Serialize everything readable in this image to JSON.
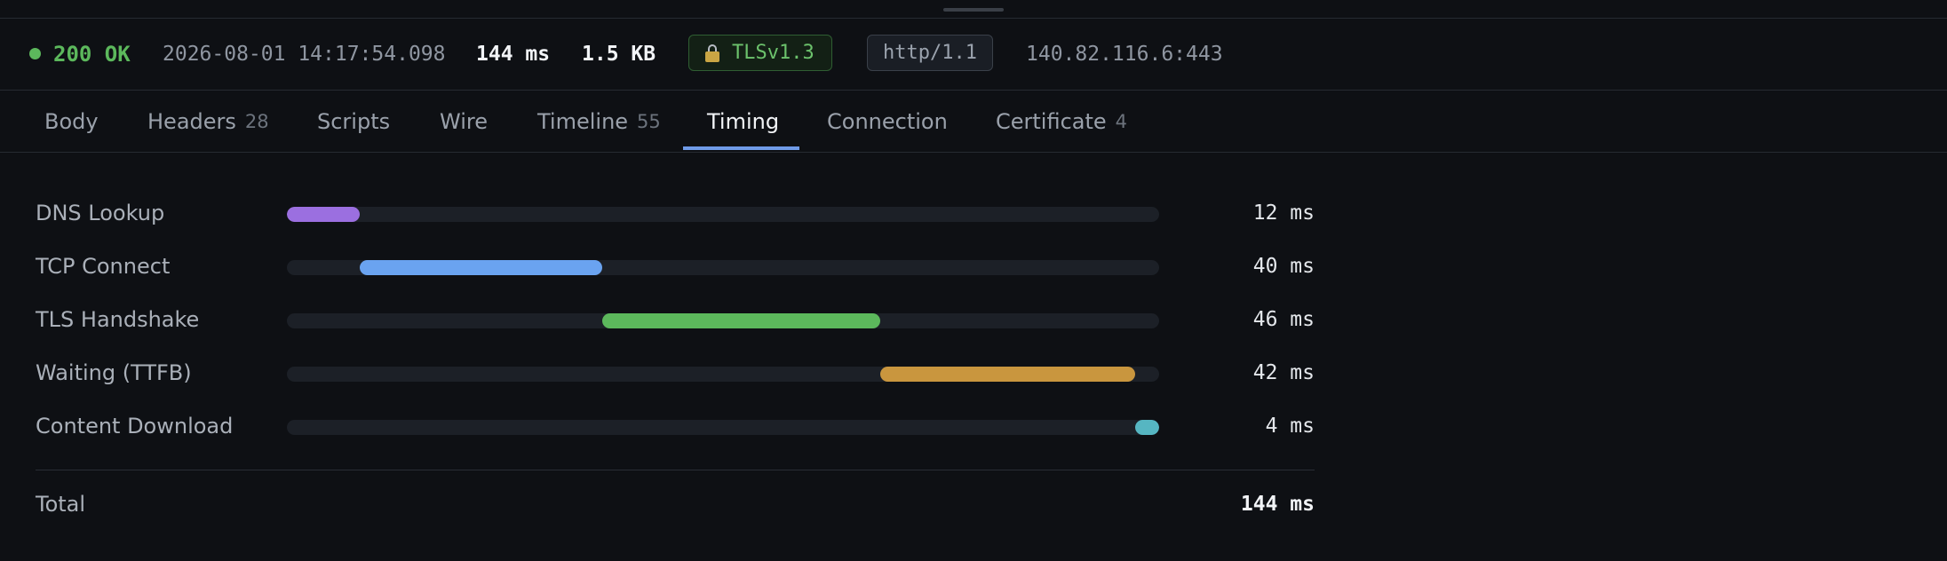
{
  "status": {
    "code_text": "200 OK",
    "timestamp": "2026-08-01 14:17:54.098",
    "duration": "144 ms",
    "size": "1.5 KB",
    "tls": "TLSv1.3",
    "protocol": "http/1.1",
    "remote": "140.82.116.6:443",
    "ok_color": "#5cb85c"
  },
  "tabs": [
    {
      "label": "Body",
      "count": ""
    },
    {
      "label": "Headers",
      "count": "28"
    },
    {
      "label": "Scripts",
      "count": ""
    },
    {
      "label": "Wire",
      "count": ""
    },
    {
      "label": "Timeline",
      "count": "55"
    },
    {
      "label": "Timing",
      "count": "",
      "active": true
    },
    {
      "label": "Connection",
      "count": ""
    },
    {
      "label": "Certificate",
      "count": "4"
    }
  ],
  "timing": {
    "total_ms": 144,
    "phases": [
      {
        "label": "DNS Lookup",
        "ms": 12,
        "value": "12 ms",
        "color": "#9b6fe0"
      },
      {
        "label": "TCP Connect",
        "ms": 40,
        "value": "40 ms",
        "color": "#6aa3f0"
      },
      {
        "label": "TLS Handshake",
        "ms": 46,
        "value": "46 ms",
        "color": "#5cb85c"
      },
      {
        "label": "Waiting (TTFB)",
        "ms": 42,
        "value": "42 ms",
        "color": "#c9963e"
      },
      {
        "label": "Content Download",
        "ms": 4,
        "value": "4 ms",
        "color": "#56b6c2"
      }
    ],
    "total_label": "Total",
    "total_value": "144 ms"
  }
}
